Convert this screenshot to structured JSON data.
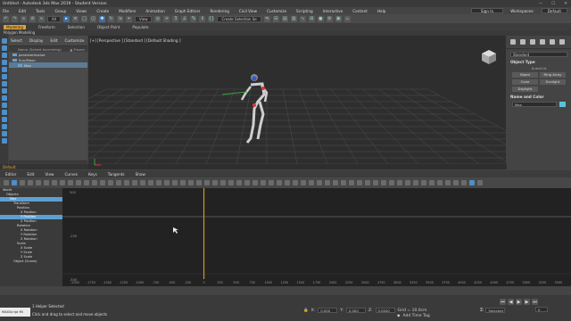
{
  "titlebar": {
    "title": "Untitled - Autodesk 3ds Max 2019 - Student Version",
    "min": "—",
    "max": "☐",
    "close": "✕"
  },
  "menubar": {
    "items": [
      "File",
      "Edit",
      "Tools",
      "Group",
      "Views",
      "Create",
      "Modifiers",
      "Animation",
      "Graph Editors",
      "Rendering",
      "Civil View",
      "Customize",
      "Scripting",
      "Interactive",
      "Content",
      "Help"
    ],
    "signin": "Sign In",
    "workspaces_label": "Workspaces:",
    "workspace": "Default"
  },
  "toolbar": {
    "selection_filter": "All",
    "create_selection_set": "Create Selection Se"
  },
  "ribbon": {
    "tabs": [
      "Modeling",
      "Freeform",
      "Selection",
      "Object Paint",
      "Populate"
    ],
    "active_index": 0,
    "sub": "Polygon Modeling"
  },
  "scene_explorer": {
    "tabs": [
      "Select",
      "Display",
      "Edit",
      "Customize"
    ],
    "column_header": "Name (Sorted Ascending)",
    "frozen_header": "▲ Frozen",
    "rows": [
      {
        "label": "persistentvalue",
        "selected": false
      },
      {
        "label": "Sun/Moon",
        "selected": false
      },
      {
        "label": "Max",
        "selected": true
      }
    ]
  },
  "viewport": {
    "label": "[+] [Perspective ] [Standard ] [Default Shading ]"
  },
  "command_panel": {
    "dropdown": "Standard",
    "rollout1": "Object Type",
    "autogrid": "AutoGrid",
    "buttons": [
      "Biped",
      "Ring Array",
      "Cone",
      "Sunlight",
      "Daylight"
    ],
    "rollout2": "Name and Color",
    "name_value": "Max",
    "color": "#5dc2d8"
  },
  "default_label": "Default",
  "graph_editor": {
    "menu": [
      "Editor",
      "Edit",
      "View",
      "Curves",
      "Keys",
      "Tangents",
      "Show"
    ],
    "tree": [
      {
        "label": "World",
        "indent": 0,
        "selected": false
      },
      {
        "label": "Objects",
        "indent": 1,
        "selected": false
      },
      {
        "label": "Max",
        "indent": 2,
        "selected": true
      },
      {
        "label": "Transform",
        "indent": 3,
        "selected": false
      },
      {
        "label": "Position",
        "indent": 4,
        "selected": false
      },
      {
        "label": "X Position",
        "indent": 5,
        "selected": false
      },
      {
        "label": "Y Position",
        "indent": 5,
        "selected": true
      },
      {
        "label": "Z Position",
        "indent": 5,
        "selected": false
      },
      {
        "label": "Rotation",
        "indent": 4,
        "selected": false
      },
      {
        "label": "X Rotation",
        "indent": 5,
        "selected": false
      },
      {
        "label": "Y Rotation",
        "indent": 5,
        "selected": false
      },
      {
        "label": "Z Rotation",
        "indent": 5,
        "selected": false
      },
      {
        "label": "Scale",
        "indent": 4,
        "selected": false
      },
      {
        "label": "X Scale",
        "indent": 5,
        "selected": false
      },
      {
        "label": "Y Scale",
        "indent": 5,
        "selected": false
      },
      {
        "label": "Z Scale",
        "indent": 5,
        "selected": false
      },
      {
        "label": "Object (Sunes)",
        "indent": 3,
        "selected": false
      }
    ],
    "y_ticks": [
      "500",
      "",
      "-250",
      "",
      "-500"
    ],
    "x_ticks": [
      "-2000",
      "-1750",
      "-1500",
      "-1250",
      "-1000",
      "-750",
      "-500",
      "-250",
      "0",
      "250",
      "500",
      "750",
      "1000",
      "1250",
      "1500",
      "1750",
      "2000",
      "2250",
      "2500",
      "2750",
      "3000",
      "3250",
      "3500",
      "3750",
      "4000",
      "4250",
      "4500",
      "4750",
      "5000",
      "5250",
      "5500"
    ],
    "time_slider_frame": 0
  },
  "statusbar": {
    "maxscript_label": "MAXScript Mi",
    "line1": "1 Helper Selected",
    "line2": "Click and drag to select and move objects",
    "x_label": "X:",
    "x_value": "0.000",
    "y_label": "Y:",
    "y_value": "0.000",
    "z_label": "Z:",
    "z_value": "0.0000",
    "grid": "Grid = 10.0cm",
    "add_time_tag": "Add Time Tag",
    "selected_label": "Selected",
    "frame": "0",
    "frame_spin": "0"
  }
}
